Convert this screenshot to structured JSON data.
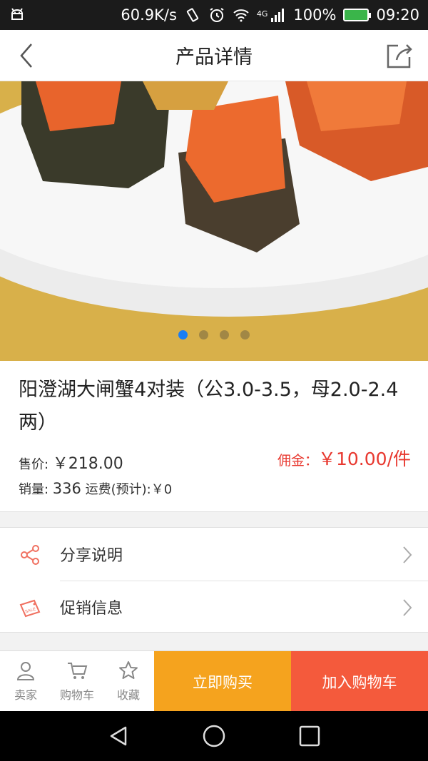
{
  "status_bar": {
    "speed": "60.9K/s",
    "network": "4G",
    "battery": "100%",
    "time": "09:20",
    "icons": [
      "android-icon",
      "vibrate-icon",
      "alarm-icon",
      "wifi-icon",
      "signal-icon",
      "battery-icon"
    ]
  },
  "header": {
    "title": "产品详情",
    "back_icon": "chevron-left-icon",
    "share_icon": "share-out-icon"
  },
  "carousel": {
    "slide_count": 4,
    "active_index": 0,
    "colors": {
      "active_dot": "#1a7ef5"
    }
  },
  "product": {
    "name": "阳澄湖大闸蟹4对装（公3.0-3.5，母2.0-2.4两）",
    "price_label": "售价: ",
    "price_value": "￥218.00",
    "commission_label": "佣金：",
    "commission_value": "￥10.00/件",
    "sales_label": "销量: ",
    "sales_value": "336",
    "shipping_text": "运费(预计):￥0"
  },
  "menu": {
    "items": [
      {
        "label": "分享说明",
        "icon": "share-nodes-icon"
      },
      {
        "label": "促销信息",
        "icon": "sale-tag-icon"
      }
    ]
  },
  "actions": {
    "seller": "卖家",
    "cart": "购物车",
    "favorite": "收藏",
    "buy_now": "立即购买",
    "add_to_cart": "加入购物车",
    "colors": {
      "buy_now": "#f5a31e",
      "add_to_cart": "#f45a3c",
      "accent_red": "#e8382f"
    }
  }
}
